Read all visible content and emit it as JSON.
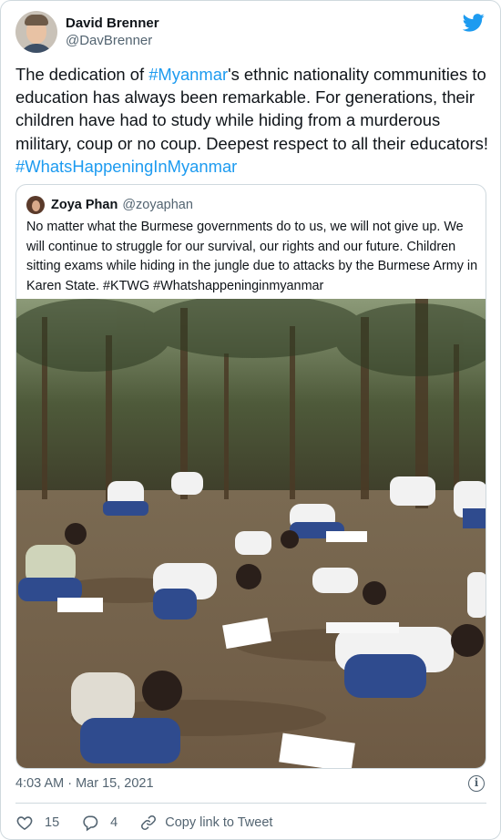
{
  "author": {
    "display_name": "David Brenner",
    "handle": "@DavBrenner"
  },
  "tweet": {
    "text_1": "The dedication of ",
    "tag_1": "#Myanmar",
    "text_2": "'s ethnic nationality communities to education has always been remarkable. For generations, their children have had to study while hiding from a murderous military, coup or no coup. Deepest respect to all their educators! ",
    "tag_2": "#WhatsHappeningInMyanmar"
  },
  "quoted": {
    "display_name": "Zoya Phan",
    "handle": "@zoyaphan",
    "text": "No matter what the Burmese governments do to us, we will not give up. We will continue to struggle for our survival, our rights and our future. Children sitting exams while hiding in the jungle due to attacks by the Burmese Army in Karen State. #KTWG #Whatshappeninginmyanmar"
  },
  "timestamp": "4:03 AM · Mar 15, 2021",
  "actions": {
    "likes": "15",
    "replies": "4",
    "copy_label": "Copy link to Tweet"
  },
  "icons": {
    "brand": "twitter-bird-icon",
    "info": "info-icon",
    "like": "heart-icon",
    "reply": "reply-icon",
    "copy": "link-icon"
  },
  "colors": {
    "accent": "#1d9bf0",
    "secondary_text": "#536471",
    "border": "#cfd9de"
  }
}
